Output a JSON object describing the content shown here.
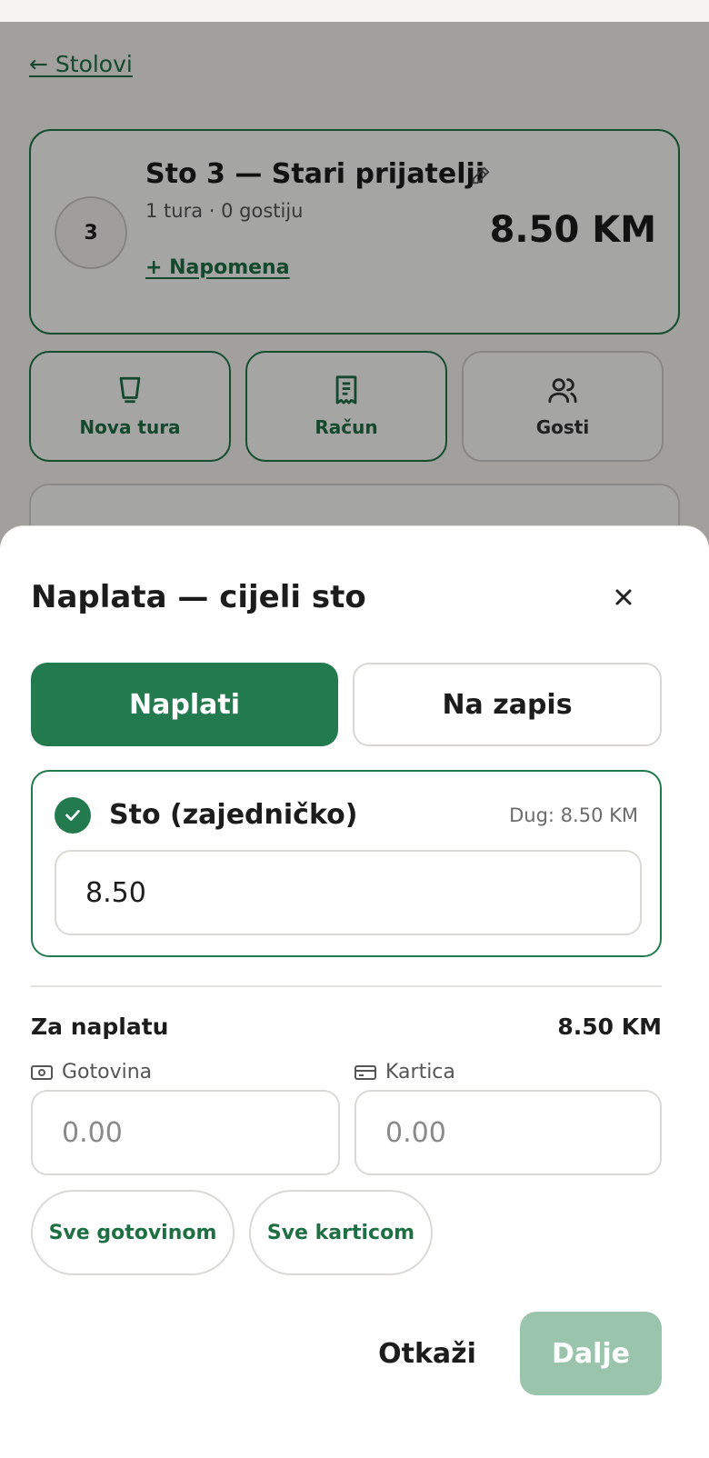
{
  "background_screen": {
    "back_link": "← Stolovi",
    "table_card": {
      "number": "3",
      "title": "Sto 3 — Stari prijatelji",
      "subtitle": "1 tura · 0 gostiju",
      "note_link": "+ Napomena",
      "total": "8.50 KM"
    },
    "actions": [
      {
        "label": "Nova tura",
        "icon": "glass-icon"
      },
      {
        "label": "Račun",
        "icon": "receipt-icon"
      },
      {
        "label": "Gosti",
        "icon": "users-icon"
      }
    ]
  },
  "sheet": {
    "title": "Naplata — cijeli sto",
    "modes": {
      "active": "Naplati",
      "inactive": "Na zapis"
    },
    "payer": {
      "name": "Sto (zajedničko)",
      "debt": "Dug: 8.50 KM",
      "amount": "8.50"
    },
    "due_label": "Za naplatu",
    "due_amount": "8.50 KM",
    "cash": {
      "label": "Gotovina",
      "placeholder": "0.00"
    },
    "card": {
      "label": "Kartica",
      "placeholder": "0.00"
    },
    "quick": {
      "all_cash": "Sve gotovinom",
      "all_card": "Sve karticom"
    },
    "cancel_label": "Otkaži",
    "next_label": "Dalje"
  },
  "colors": {
    "accent": "#237a4f",
    "accent_disabled": "#9bc4ad"
  }
}
